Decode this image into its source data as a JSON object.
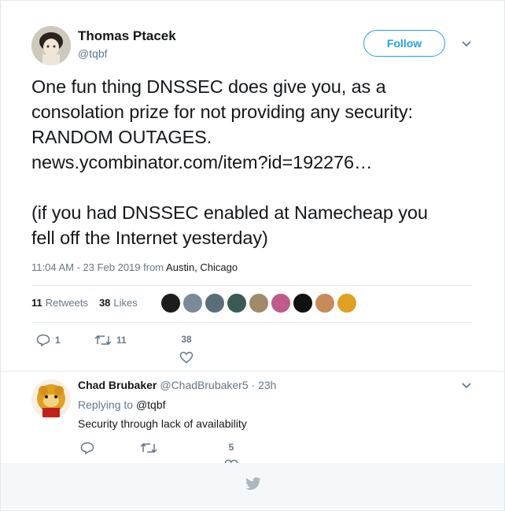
{
  "tweet": {
    "author_name": "Thomas Ptacek",
    "author_handle": "@tqbf",
    "follow_label": "Follow",
    "text_lines": [
      "One fun thing DNSSEC does give you, as a",
      "consolation prize for not providing any security:",
      "RANDOM OUTAGES."
    ],
    "link": "news.ycombinator.com/item?id=192276…",
    "text_lines2": [
      "(if you had DNSSEC enabled at Namecheap you",
      "fell off the Internet yesterday)"
    ],
    "time": "11:04 AM - 23 Feb 2019 from",
    "location": "Austin, Chicago",
    "retweets_count": "11",
    "retweets_label": "Retweets",
    "likes_count": "38",
    "likes_label": "Likes",
    "liker_colors": [
      "#1c1c1c",
      "#7a8a9a",
      "#5a6e7a",
      "#3a5a55",
      "#a08a6a",
      "#c05a8a",
      "#111111",
      "#c88a5a",
      "#e0a020"
    ],
    "actions": {
      "replies": "1",
      "retweets": "11",
      "likes": "38"
    }
  },
  "reply": {
    "author_name": "Chad Brubaker",
    "author_handle": "@ChadBrubaker5",
    "time": "· 23h",
    "replying_to_label": "Replying to",
    "replying_to_user": "@tqbf",
    "text": "Security through lack of availability",
    "actions": {
      "likes": "5"
    }
  },
  "colors": {
    "accent": "#1da1f2",
    "muted": "#657786",
    "text": "#14171a"
  }
}
